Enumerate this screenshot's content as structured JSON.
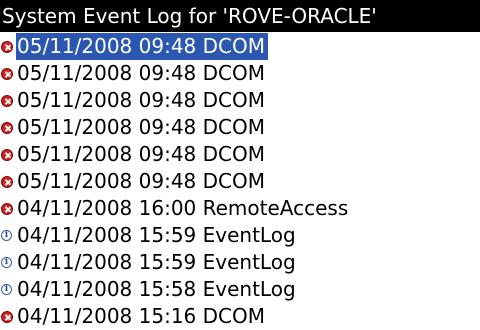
{
  "title": "System Event Log for 'ROVE-ORACLE'",
  "colors": {
    "title_bar_bg": "#000000",
    "selection_bg": "#2b57b0",
    "error_icon": "#d42020",
    "info_icon": "#3a5aa8"
  },
  "events": [
    {
      "type": "error",
      "icon": "error-icon",
      "text": "05/11/2008 09:48 DCOM",
      "selected": true
    },
    {
      "type": "error",
      "icon": "error-icon",
      "text": "05/11/2008 09:48 DCOM"
    },
    {
      "type": "error",
      "icon": "error-icon",
      "text": "05/11/2008 09:48 DCOM"
    },
    {
      "type": "error",
      "icon": "error-icon",
      "text": "05/11/2008 09:48 DCOM"
    },
    {
      "type": "error",
      "icon": "error-icon",
      "text": "05/11/2008 09:48 DCOM"
    },
    {
      "type": "error",
      "icon": "error-icon",
      "text": "05/11/2008 09:48 DCOM"
    },
    {
      "type": "error",
      "icon": "error-icon",
      "text": "04/11/2008 16:00 RemoteAccess"
    },
    {
      "type": "info",
      "icon": "info-icon",
      "text": "04/11/2008 15:59 EventLog"
    },
    {
      "type": "info",
      "icon": "info-icon",
      "text": "04/11/2008 15:59 EventLog"
    },
    {
      "type": "info",
      "icon": "info-icon",
      "text": "04/11/2008 15:58 EventLog"
    },
    {
      "type": "error",
      "icon": "error-icon",
      "text": "04/11/2008 15:16 DCOM"
    }
  ]
}
